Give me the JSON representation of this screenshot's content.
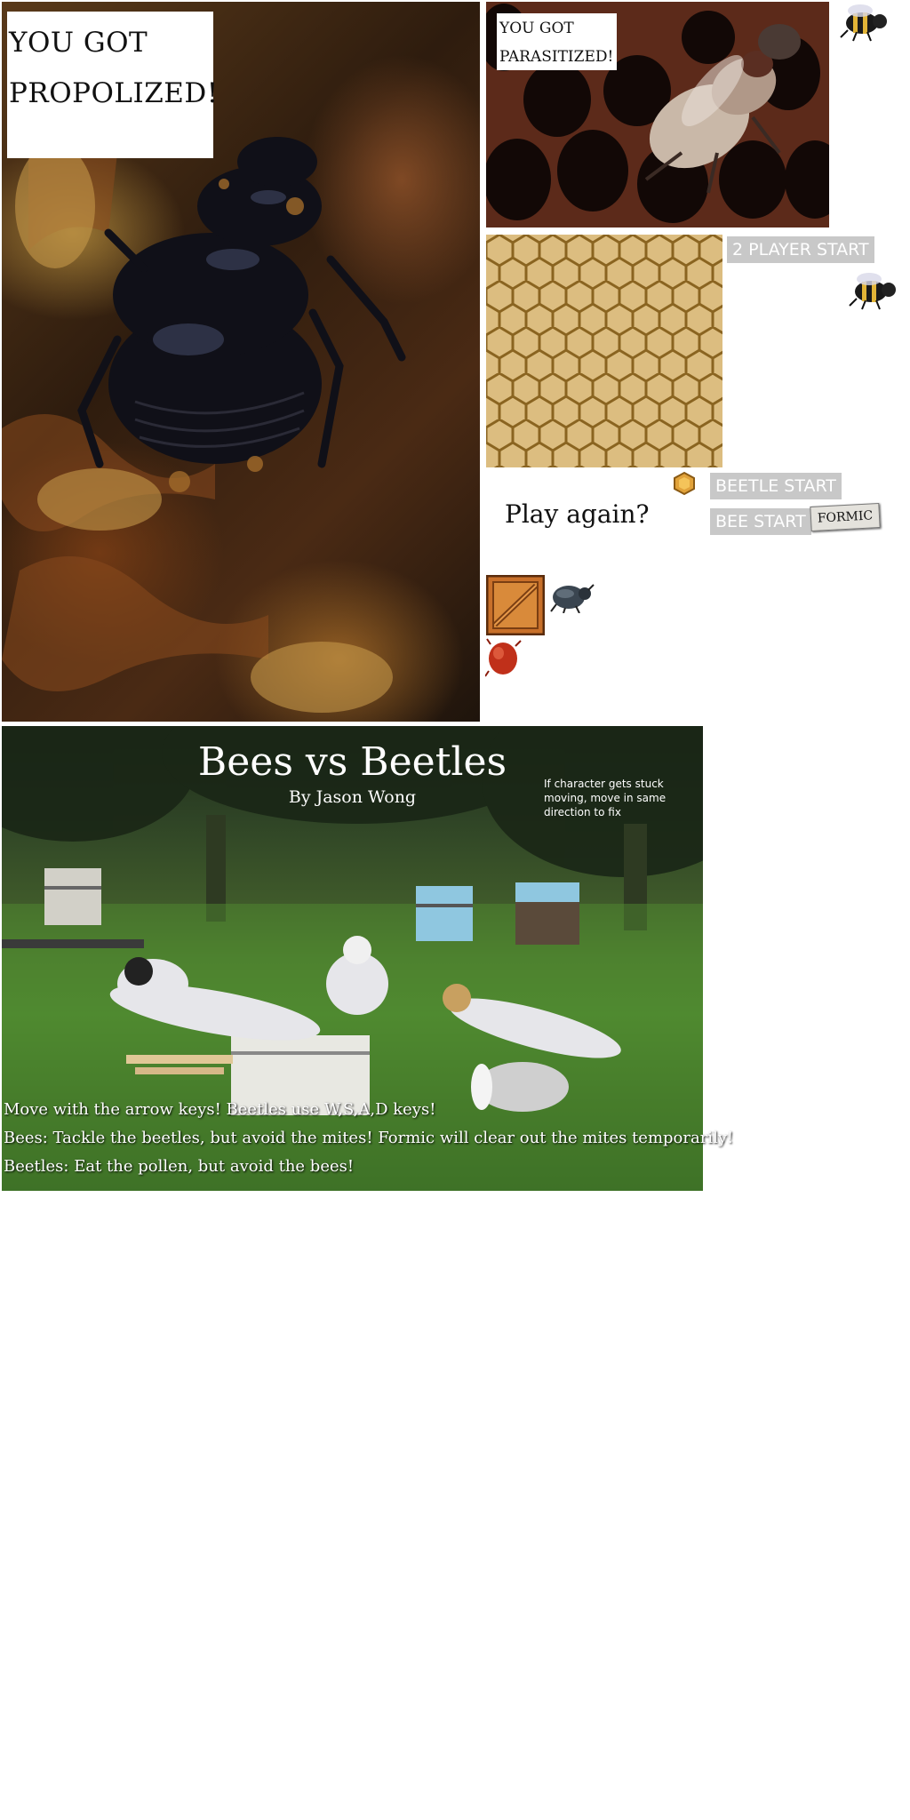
{
  "screens": {
    "propolized": {
      "message": "YOU GOT PROPOLIZED!"
    },
    "parasitized": {
      "message": "YOU GOT PARASITIZED!"
    }
  },
  "menu": {
    "two_player_start": "2 PLAYER START",
    "beetle_start": "BEETLE START",
    "bee_start": "BEE START",
    "formic": "FORMIC",
    "play_again": "Play again?"
  },
  "title_screen": {
    "title": "Bees vs Beetles",
    "byline": "By Jason Wong",
    "stuck_hint": "If character gets stuck moving, move in same direction to fix",
    "instructions": [
      "Move with the arrow keys! Beetles use W,S,A,D keys!",
      "Bees: Tackle the beetles, but avoid the mites!  Formic will clear out the mites temporarily!",
      "Beetles: Eat the pollen, but avoid the bees!"
    ]
  },
  "sprites": [
    "bee-sprite",
    "bee-sprite-2",
    "beetle-sprite",
    "crate-sprite",
    "pollen-sprite",
    "mite-sprite"
  ]
}
